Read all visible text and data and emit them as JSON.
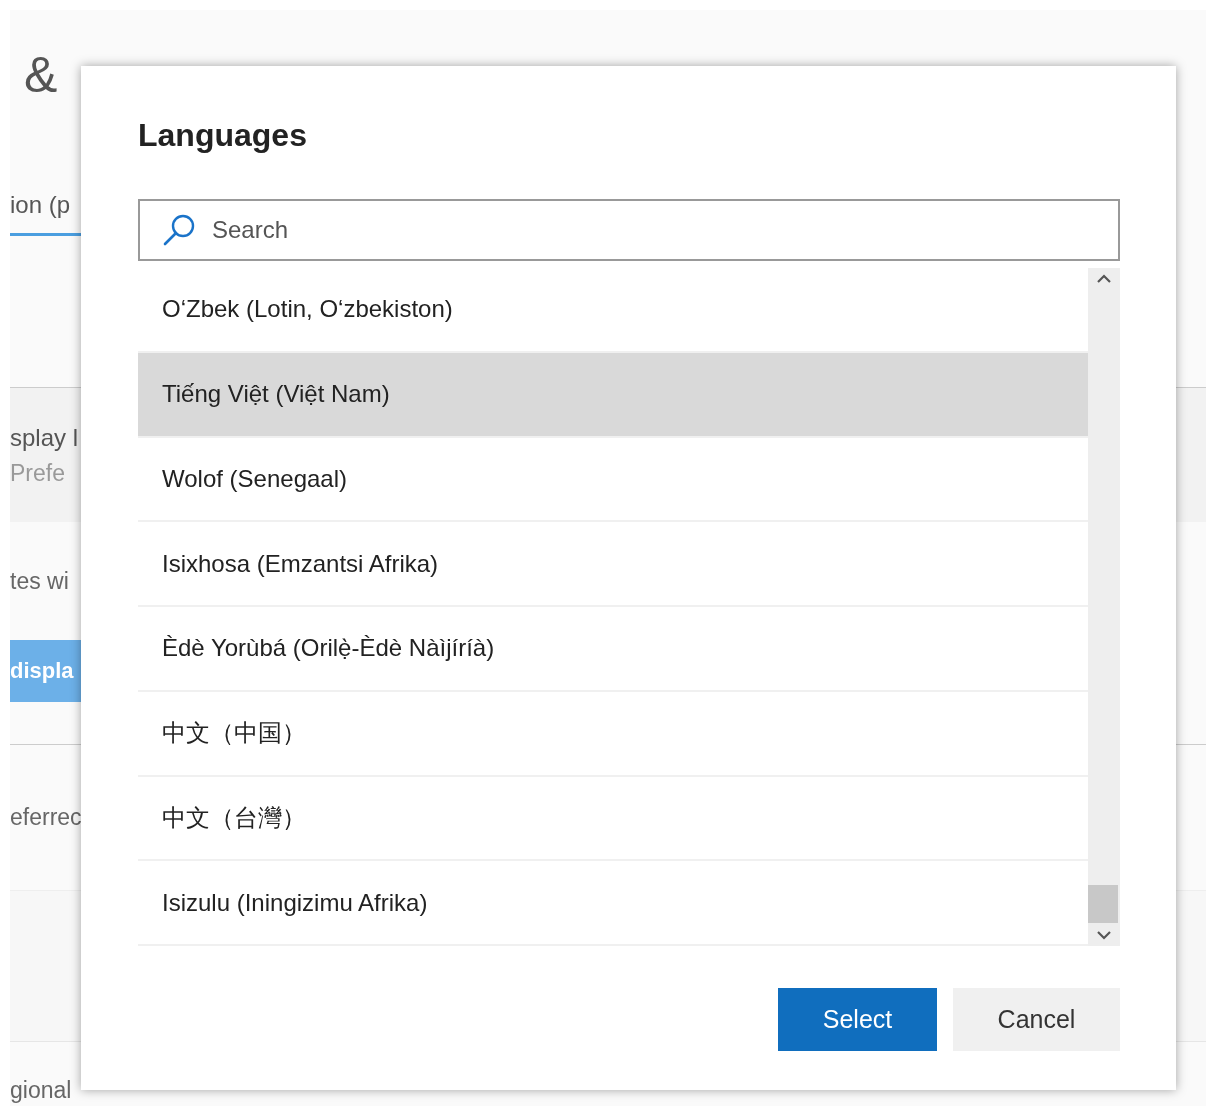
{
  "background": {
    "heading": "&",
    "tab": {
      "label": "ion (p",
      "selected": true
    },
    "section_title": "splay l",
    "section_subtitle": "Prefe",
    "note": "tes wi",
    "button": "displa",
    "row_label": "eferrec",
    "footer_label": "gional"
  },
  "dialog": {
    "title": "Languages",
    "search": {
      "placeholder": "Search"
    },
    "languages": [
      {
        "label": "O‘Zbek (Lotin, O‘zbekiston)",
        "selected": false
      },
      {
        "label": "Tiếng Việt (Việt Nam)",
        "selected": true
      },
      {
        "label": "Wolof (Senegaal)",
        "selected": false
      },
      {
        "label": "Isixhosa (Emzantsi Afrika)",
        "selected": false
      },
      {
        "label": "Èdè Yorùbá (Orilẹ̀-Èdè Nàìjíríà)",
        "selected": false
      },
      {
        "label": "中文（中国）",
        "selected": false
      },
      {
        "label": "中文（台灣）",
        "selected": false
      },
      {
        "label": "Isizulu (Iningizimu Afrika)",
        "selected": false
      }
    ],
    "buttons": [
      {
        "label": "Select",
        "kind": "primary"
      },
      {
        "label": "Cancel",
        "kind": "secondary"
      }
    ]
  }
}
